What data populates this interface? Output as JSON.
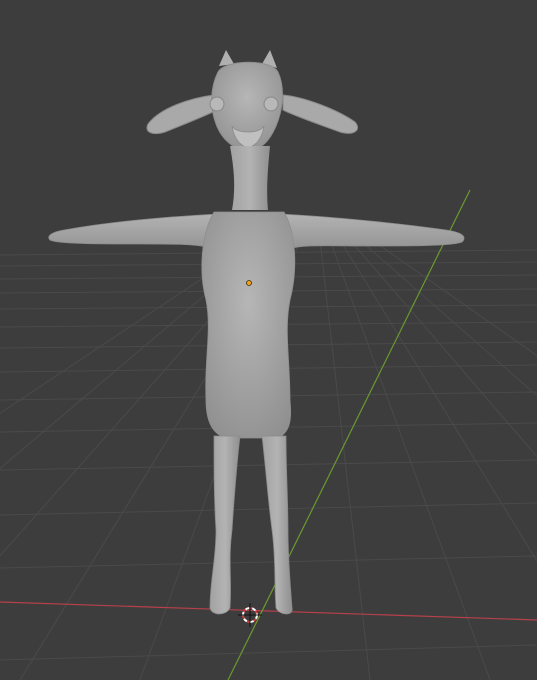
{
  "viewport": {
    "background_color": "#3d3d3d",
    "grid_color": "#4a4a4a",
    "x_axis_color": "#b5414a",
    "y_axis_color": "#6a9a2e",
    "model_color": "#a7a7a7",
    "origin_marker_color": "#f2a020",
    "cursor_colors": [
      "#d33a3a",
      "#ffffff"
    ],
    "object": "goat-character-mesh",
    "pose": "t-pose"
  }
}
